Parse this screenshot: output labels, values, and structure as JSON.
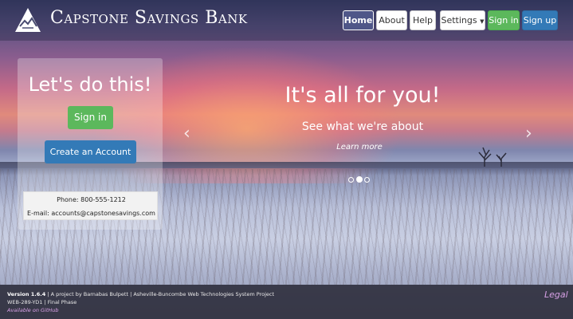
{
  "brand": {
    "name": "Capstone Savings Bank",
    "logo_icon": "mountain-logo-icon"
  },
  "nav": {
    "home": "Home",
    "about": "About",
    "help": "Help",
    "settings": "Settings",
    "sign_in": "Sign in",
    "sign_up": "Sign up"
  },
  "panel": {
    "title": "Let's do this!",
    "sign_in": "Sign in",
    "create_account": "Create an Account",
    "phone": "Phone: 800-555-1212",
    "email": "E-mail: accounts@capstonesavings.com"
  },
  "carousel": {
    "title": "It's all for you!",
    "subtitle": "See what we're about",
    "link": "Learn more",
    "prev": "‹",
    "next": "›",
    "slide_count": 3,
    "active_slide": 2
  },
  "footer": {
    "version": "Version 1.6.4",
    "credits": " | A project by Barnabas Bulpett | Asheville-Buncombe Web Technologies System Project",
    "course": "WEB-289-YD1 | Final Phase",
    "github": "Available on GitHub",
    "legal": "Legal"
  },
  "colors": {
    "success": "#5cb85c",
    "primary": "#337ab7",
    "nav_active": "#4f5688",
    "accent_link": "#d7a1e6"
  }
}
